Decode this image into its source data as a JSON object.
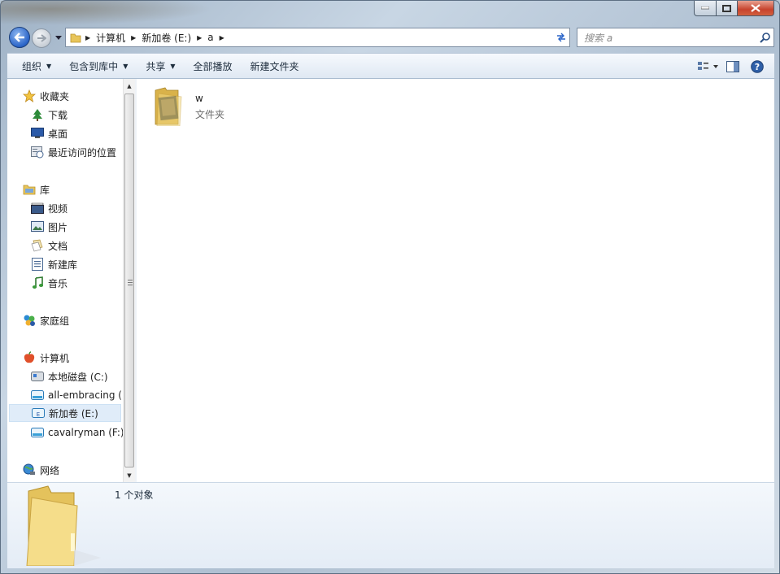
{
  "window": {
    "caption_buttons": [
      "minimize",
      "maximize",
      "close"
    ]
  },
  "address": {
    "segments": [
      "计算机",
      "新加卷 (E:)",
      "a"
    ]
  },
  "search": {
    "placeholder": "搜索 a"
  },
  "toolbar": {
    "organize": "组织",
    "include_in_library": "包含到库中",
    "share": "共享",
    "play_all": "全部播放",
    "new_folder": "新建文件夹"
  },
  "nav": {
    "favorites": {
      "label": "收藏夹",
      "items": [
        "下载",
        "桌面",
        "最近访问的位置"
      ]
    },
    "libraries": {
      "label": "库",
      "items": [
        "视频",
        "图片",
        "文档",
        "新建库",
        "音乐"
      ]
    },
    "homegroup": {
      "label": "家庭组"
    },
    "computer": {
      "label": "计算机",
      "items": [
        "本地磁盘 (C:)",
        "all-embracing (",
        "新加卷 (E:)",
        "cavalryman (F:)"
      ],
      "selected": "新加卷 (E:)"
    },
    "network": {
      "label": "网络"
    }
  },
  "files": [
    {
      "name": "w",
      "type": "文件夹",
      "icon": "folder-with-pictures-icon"
    }
  ],
  "details": {
    "count_text": "1 个对象"
  },
  "colors": {
    "accent": "#2a64c8",
    "close": "#c7432d",
    "selection": "#e0ecf9"
  }
}
